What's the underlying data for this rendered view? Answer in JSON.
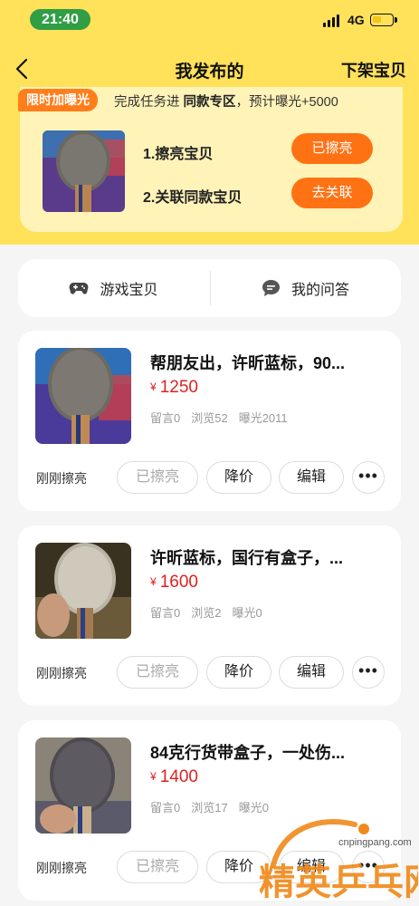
{
  "status_bar": {
    "time": "21:40",
    "network": "4G"
  },
  "nav": {
    "title": "我发布的",
    "action": "下架宝贝"
  },
  "promo": {
    "tag": "限时加曝光",
    "text_prefix": "完成任务进",
    "text_highlight": "同款专区",
    "text_suffix": "，预计曝光+5000",
    "tasks": [
      {
        "label": "1.擦亮宝贝",
        "button": "已擦亮"
      },
      {
        "label": "2.关联同款宝贝",
        "button": "去关联"
      }
    ]
  },
  "tabs": [
    {
      "label": "游戏宝贝",
      "icon": "gamepad-icon"
    },
    {
      "label": "我的问答",
      "icon": "chat-bubble-icon"
    }
  ],
  "items": [
    {
      "title": "帮朋友出，许昕蓝标，90...",
      "currency": "¥",
      "price": "1250",
      "comments": "留言0",
      "views": "浏览52",
      "exposure": "曝光2011",
      "status": "刚刚擦亮",
      "buttons": {
        "shine": "已擦亮",
        "reduce": "降价",
        "edit": "编辑",
        "more": "•••"
      }
    },
    {
      "title": "许昕蓝标，国行有盒子，...",
      "currency": "¥",
      "price": "1600",
      "comments": "留言0",
      "views": "浏览2",
      "exposure": "曝光0",
      "status": "刚刚擦亮",
      "buttons": {
        "shine": "已擦亮",
        "reduce": "降价",
        "edit": "编辑",
        "more": "•••"
      }
    },
    {
      "title": "84克行货带盒子，一处伤...",
      "currency": "¥",
      "price": "1400",
      "comments": "留言0",
      "views": "浏览17",
      "exposure": "曝光0",
      "status": "刚刚擦亮",
      "buttons": {
        "shine": "已擦亮",
        "reduce": "降价",
        "edit": "编辑",
        "more": "•••"
      }
    }
  ],
  "watermark": {
    "url": "cnpingpang.com",
    "text": "精英乒乓网"
  },
  "colors": {
    "header_yellow": "#ffe15a",
    "accent_orange": "#ff7214",
    "price_red": "#e02020",
    "time_green": "#2f9e45"
  }
}
